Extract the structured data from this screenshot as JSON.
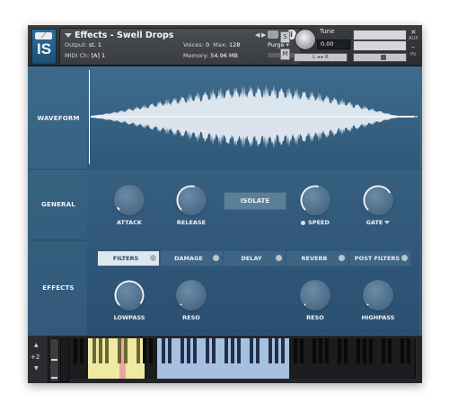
{
  "header": {
    "logo_text": "IS",
    "logo_icon": "wrench-icon",
    "title": "Effects - Swell Drops",
    "output_label": "Output:",
    "output_value": "st. 1",
    "voices_label": "Voices:",
    "voices_value": "0",
    "max_label": "Max:",
    "max_value": "128",
    "purge_label": "Purge",
    "midi_label": "MIDI Ch:",
    "midi_value": "[A]  1",
    "memory_label": "Memory:",
    "memory_value": "54.96 MB",
    "s_button": "S",
    "m_button": "M",
    "tune_label": "Tune",
    "tune_value": "0.00",
    "lr_label": "L ◂ ▸ R",
    "close_label": "×",
    "minimize_label": "–",
    "aux_label": "AUX",
    "pv_label": "PV"
  },
  "sections": {
    "waveform": "WAVEFORM",
    "general": "GENERAL",
    "effects": "EFFECTS"
  },
  "general": {
    "attack": "ATTACK",
    "release": "RELEASE",
    "isolate": "ISOLATE",
    "speed": "SPEED",
    "gate": "GATE"
  },
  "effects": {
    "tabs": [
      {
        "label": "FILTERS",
        "active": true
      },
      {
        "label": "DAMAGE",
        "active": false
      },
      {
        "label": "DELAY",
        "active": false
      },
      {
        "label": "REVERB",
        "active": false
      },
      {
        "label": "POST FILTERS",
        "active": false
      }
    ],
    "knobs": {
      "lowpass": "LOWPASS",
      "reso1": "RESO",
      "reso2": "RESO",
      "highpass": "HIGHPASS"
    }
  },
  "knob_levels": {
    "attack": 0.05,
    "release": 0.55,
    "speed": 0.55,
    "gate": 0.72,
    "lowpass": 0.97,
    "reso1": 0.02,
    "reso2": 0.02,
    "highpass": 0.02
  },
  "keyboard": {
    "octave": "+2",
    "octave_up_icon": "arrow-up-icon",
    "octave_down_icon": "arrow-down-icon"
  },
  "colors": {
    "keyswitch_yellow": "#efe9a4",
    "key_pressed_pink": "#e8a6a8",
    "mapped_blue": "#a6c0e2",
    "arc": "#f2f5f8"
  }
}
